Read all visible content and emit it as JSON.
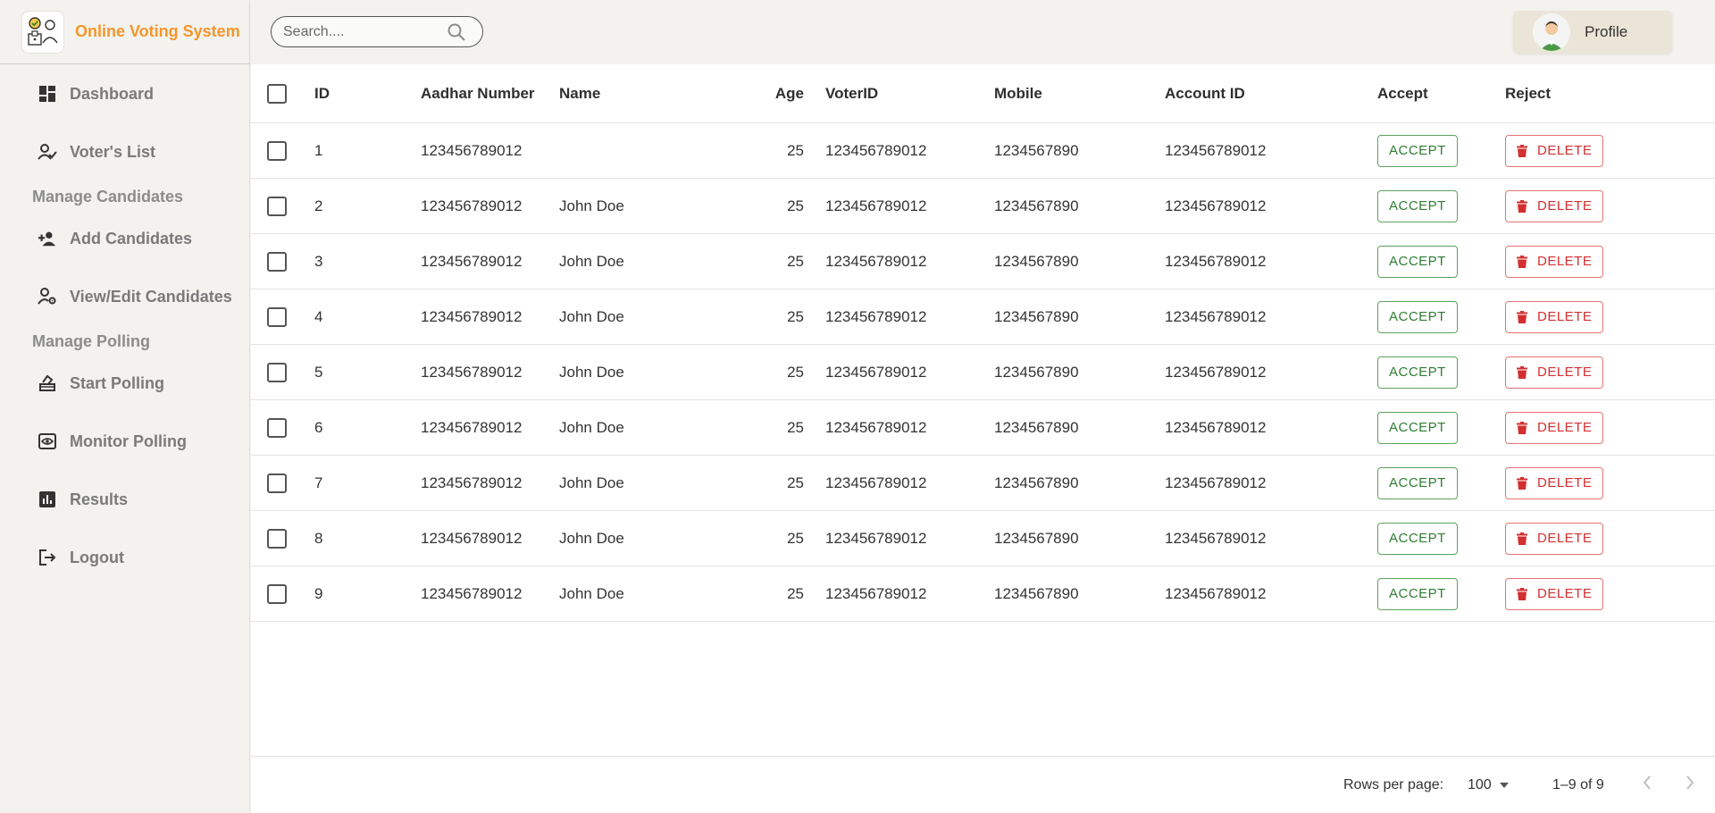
{
  "app": {
    "title": "Online Voting System"
  },
  "sidebar": {
    "items": [
      {
        "label": "Dashboard",
        "icon": "dashboard-icon"
      },
      {
        "label": "Voter's List",
        "icon": "voter-check-icon"
      },
      {
        "section": "Manage Candidates"
      },
      {
        "label": "Add Candidates",
        "icon": "add-person-icon"
      },
      {
        "label": "View/Edit Candidates",
        "icon": "person-gear-icon"
      },
      {
        "section": "Manage Polling"
      },
      {
        "label": "Start Polling",
        "icon": "ballot-box-icon"
      },
      {
        "label": "Monitor Polling",
        "icon": "monitor-eye-icon"
      },
      {
        "label": "Results",
        "icon": "bar-chart-icon"
      },
      {
        "label": "Logout",
        "icon": "logout-icon"
      }
    ],
    "labels": {
      "dashboard": "Dashboard",
      "voters_list": "Voter's List",
      "manage_candidates": "Manage Candidates",
      "add_candidates": "Add Candidates",
      "view_edit_candidates": "View/Edit Candidates",
      "manage_polling": "Manage Polling",
      "start_polling": "Start Polling",
      "monitor_polling": "Monitor Polling",
      "results": "Results",
      "logout": "Logout"
    }
  },
  "topbar": {
    "search_placeholder": "Search....",
    "search_value": "",
    "profile_label": "Profile"
  },
  "table": {
    "columns": {
      "id": "ID",
      "aadhar": "Aadhar Number",
      "name": "Name",
      "age": "Age",
      "voter_id": "VoterID",
      "mobile": "Mobile",
      "account_id": "Account ID",
      "accept": "Accept",
      "reject": "Reject"
    },
    "accept_label": "ACCEPT",
    "delete_label": "DELETE",
    "rows": [
      {
        "id": "1",
        "aadhar": "123456789012",
        "name": "",
        "age": "25",
        "voter_id": "123456789012",
        "mobile": "1234567890",
        "account_id": "123456789012"
      },
      {
        "id": "2",
        "aadhar": "123456789012",
        "name": "John Doe",
        "age": "25",
        "voter_id": "123456789012",
        "mobile": "1234567890",
        "account_id": "123456789012"
      },
      {
        "id": "3",
        "aadhar": "123456789012",
        "name": "John Doe",
        "age": "25",
        "voter_id": "123456789012",
        "mobile": "1234567890",
        "account_id": "123456789012"
      },
      {
        "id": "4",
        "aadhar": "123456789012",
        "name": "John Doe",
        "age": "25",
        "voter_id": "123456789012",
        "mobile": "1234567890",
        "account_id": "123456789012"
      },
      {
        "id": "5",
        "aadhar": "123456789012",
        "name": "John Doe",
        "age": "25",
        "voter_id": "123456789012",
        "mobile": "1234567890",
        "account_id": "123456789012"
      },
      {
        "id": "6",
        "aadhar": "123456789012",
        "name": "John Doe",
        "age": "25",
        "voter_id": "123456789012",
        "mobile": "1234567890",
        "account_id": "123456789012"
      },
      {
        "id": "7",
        "aadhar": "123456789012",
        "name": "John Doe",
        "age": "25",
        "voter_id": "123456789012",
        "mobile": "1234567890",
        "account_id": "123456789012"
      },
      {
        "id": "8",
        "aadhar": "123456789012",
        "name": "John Doe",
        "age": "25",
        "voter_id": "123456789012",
        "mobile": "1234567890",
        "account_id": "123456789012"
      },
      {
        "id": "9",
        "aadhar": "123456789012",
        "name": "John Doe",
        "age": "25",
        "voter_id": "123456789012",
        "mobile": "1234567890",
        "account_id": "123456789012"
      }
    ]
  },
  "footer": {
    "rows_per_page_label": "Rows per page:",
    "rows_per_page_value": "100",
    "range": "1–9 of 9"
  },
  "colors": {
    "brand": "#f4962a",
    "accept": "#2e7d32",
    "delete": "#d32f2f",
    "sidebar_bg": "#f3f2ef",
    "profile_bg": "#ebe5d8"
  }
}
